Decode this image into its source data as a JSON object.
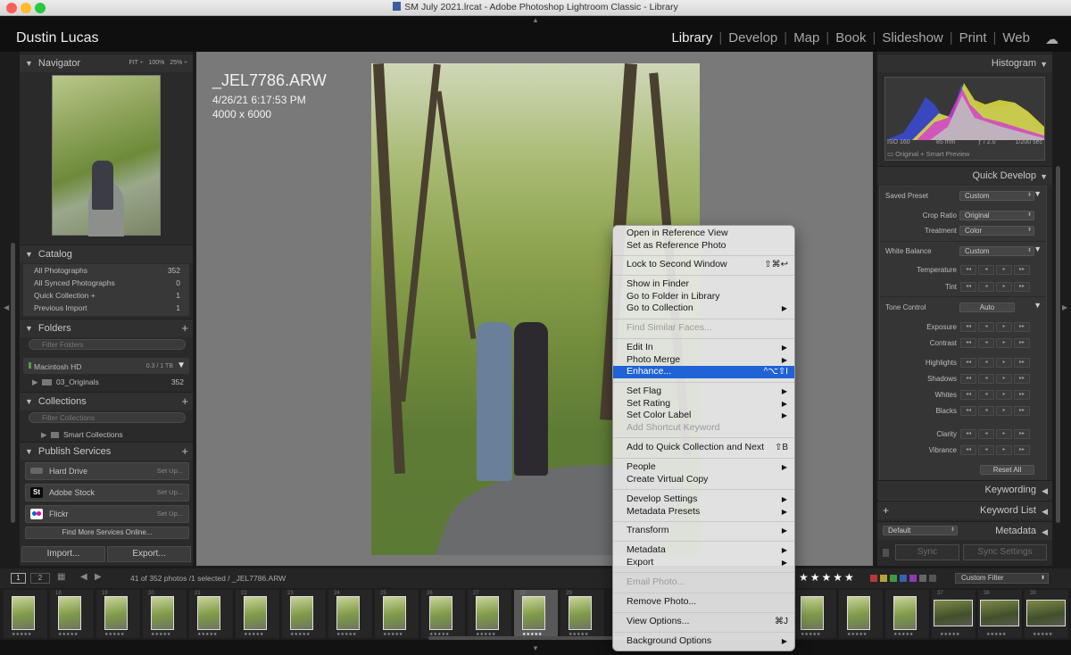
{
  "window": {
    "title": "SM July 2021.lrcat - Adobe Photoshop Lightroom Classic - Library"
  },
  "identity_plate": "Dustin Lucas",
  "modules": [
    "Library",
    "Develop",
    "Map",
    "Book",
    "Slideshow",
    "Print",
    "Web"
  ],
  "active_module": "Library",
  "left_panel": {
    "navigator": {
      "title": "Navigator",
      "zoom_options": [
        "FIT ÷",
        "100%",
        "25% ÷"
      ]
    },
    "catalog": {
      "title": "Catalog",
      "items": [
        {
          "label": "All Photographs",
          "count": "352"
        },
        {
          "label": "All Synced Photographs",
          "count": "0"
        },
        {
          "label": "Quick Collection +",
          "count": "1"
        },
        {
          "label": "Previous Import",
          "count": "1"
        }
      ]
    },
    "folders": {
      "title": "Folders",
      "filter_placeholder": "Filter Folders",
      "volume": "Macintosh HD",
      "volume_space": "0.3 / 1 TB",
      "folder": "03_Originals",
      "folder_count": "352"
    },
    "collections": {
      "title": "Collections",
      "filter_placeholder": "Filter Collections",
      "item": "Smart Collections"
    },
    "publish": {
      "title": "Publish Services",
      "services": [
        {
          "label": "Hard Drive",
          "action": "Set Up..."
        },
        {
          "label": "Adobe Stock",
          "action": "Set Up..."
        },
        {
          "label": "Flickr",
          "action": "Set Up..."
        }
      ],
      "find_more": "Find More Services Online..."
    },
    "import_label": "Import...",
    "export_label": "Export..."
  },
  "photo_info": {
    "filename": "_JEL7786.ARW",
    "datetime": "4/26/21 6:17:53 PM",
    "dimensions": "4000 x 6000"
  },
  "right_panel": {
    "histogram": {
      "title": "Histogram",
      "iso": "ISO 160",
      "focal": "85 mm",
      "aperture": "ƒ / 2.0",
      "shutter": "1/200 sec",
      "preview": "Original + Smart Preview"
    },
    "quick_develop": {
      "title": "Quick Develop",
      "saved_preset_label": "Saved Preset",
      "saved_preset_value": "Custom",
      "crop_label": "Crop Ratio",
      "crop_value": "Original",
      "treatment_label": "Treatment",
      "treatment_value": "Color",
      "wb_label": "White Balance",
      "wb_value": "Custom",
      "temperature": "Temperature",
      "tint": "Tint",
      "tone_label": "Tone Control",
      "auto": "Auto",
      "exposure": "Exposure",
      "contrast": "Contrast",
      "highlights": "Highlights",
      "shadows": "Shadows",
      "whites": "Whites",
      "blacks": "Blacks",
      "clarity": "Clarity",
      "vibrance": "Vibrance",
      "reset": "Reset All"
    },
    "keywording": "Keywording",
    "keyword_list": "Keyword List",
    "metadata": "Metadata",
    "metadata_preset": "Default",
    "sync": "Sync",
    "sync_settings": "Sync Settings"
  },
  "filmstrip": {
    "page1": "1",
    "page2": "2",
    "status": "41 of 352 photos /1 selected / _JEL7786.ARW",
    "rating_filter": "★★★★★",
    "filter": "Custom Filter",
    "numbers": [
      "",
      "18",
      "19",
      "20",
      "21",
      "22",
      "23",
      "24",
      "25",
      "26",
      "27",
      "28",
      "29",
      "",
      "",
      "",
      "",
      "",
      "37",
      "38",
      "39"
    ]
  },
  "context_menu": {
    "items": [
      {
        "label": "Open in Reference View",
        "enabled": true
      },
      {
        "label": "Set as Reference Photo",
        "enabled": true
      },
      {
        "label": "Lock to Second Window",
        "shortcut": "⇧⌘↩",
        "enabled": true
      },
      {
        "label": "Show in Finder",
        "enabled": true
      },
      {
        "label": "Go to Folder in Library",
        "enabled": true
      },
      {
        "label": "Go to Collection",
        "submenu": true,
        "enabled": true
      },
      {
        "label": "Find Similar Faces...",
        "enabled": false
      },
      {
        "label": "Edit In",
        "submenu": true,
        "enabled": true
      },
      {
        "label": "Photo Merge",
        "submenu": true,
        "enabled": true
      },
      {
        "label": "Enhance...",
        "shortcut": "^⌥⇧I",
        "enabled": true,
        "highlighted": true
      },
      {
        "label": "Set Flag",
        "submenu": true,
        "enabled": true
      },
      {
        "label": "Set Rating",
        "submenu": true,
        "enabled": true
      },
      {
        "label": "Set Color Label",
        "submenu": true,
        "enabled": true
      },
      {
        "label": "Add Shortcut Keyword",
        "enabled": false
      },
      {
        "label": "Add to Quick Collection and Next",
        "shortcut": "⇧B",
        "enabled": true
      },
      {
        "label": "People",
        "submenu": true,
        "enabled": true
      },
      {
        "label": "Create Virtual Copy",
        "enabled": true
      },
      {
        "label": "Develop Settings",
        "submenu": true,
        "enabled": true
      },
      {
        "label": "Metadata Presets",
        "submenu": true,
        "enabled": true
      },
      {
        "label": "Transform",
        "submenu": true,
        "enabled": true
      },
      {
        "label": "Metadata",
        "submenu": true,
        "enabled": true
      },
      {
        "label": "Export",
        "submenu": true,
        "enabled": true
      },
      {
        "label": "Email Photo...",
        "enabled": false
      },
      {
        "label": "Remove Photo...",
        "enabled": true
      },
      {
        "label": "View Options...",
        "shortcut": "⌘J",
        "enabled": true
      },
      {
        "label": "Background Options",
        "submenu": true,
        "enabled": true
      }
    ]
  },
  "colors": {
    "accent": "#1f63d6",
    "panel": "#2a2a2a",
    "loupe_bg": "#797979"
  }
}
